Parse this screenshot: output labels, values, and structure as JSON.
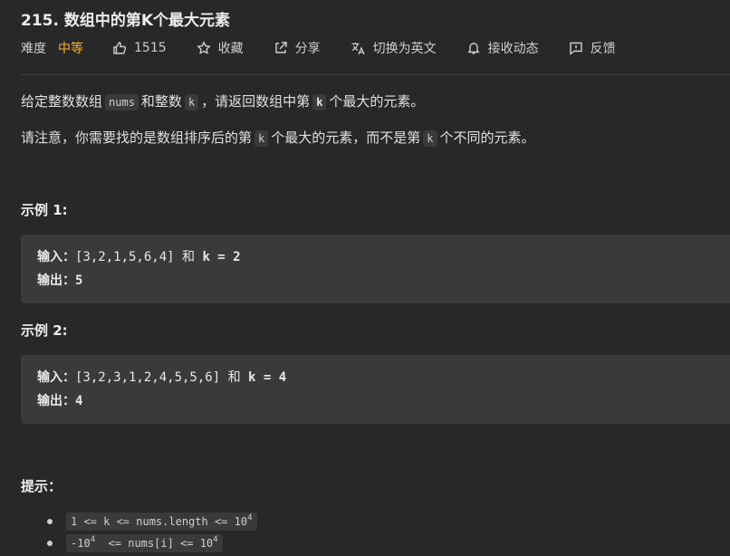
{
  "problem": {
    "title": "215. 数组中的第K个最大元素",
    "difficulty_label": "难度",
    "difficulty": "中等",
    "likes": "1515",
    "actions": {
      "favorite": "收藏",
      "share": "分享",
      "translate": "切换为英文",
      "subscribe": "接收动态",
      "feedback": "反馈"
    }
  },
  "description": {
    "p1": {
      "t1": "给定整数数组",
      "c1": "nums",
      "t2": "和整数",
      "c2": "k",
      "t3": "，请返回数组中第",
      "c3": "k",
      "t4": "个最大的元素。"
    },
    "p2": {
      "t1": "请注意，你需要找的是数组排序后的第",
      "c1": "k",
      "t2": "个最大的元素，而不是第",
      "c2": "k",
      "t3": "个不同的元素。"
    }
  },
  "examples": [
    {
      "title": "示例 1:",
      "input_label": "输入：",
      "input_value": "[3,2,1,5,6,4]",
      "and_word": "和",
      "k_expr": "k = 2",
      "output_label": "输出：",
      "output_value": "5"
    },
    {
      "title": "示例 2:",
      "input_label": "输入：",
      "input_value": "[3,2,3,1,2,4,5,5,6]",
      "and_word": "和",
      "k_expr": "k = 4",
      "output_label": "输出：",
      "output_value": "4"
    }
  ],
  "hints": {
    "title": "提示：",
    "items": [
      {
        "text": "1 <= k <= nums.length <= 10",
        "sup": "4"
      },
      {
        "pre": "-10",
        "pre_sup": "4",
        "text": "  <= nums[i] <= 10",
        "sup": "4"
      }
    ]
  },
  "colors": {
    "background": "#282828",
    "difficulty_medium": "#ffb02e",
    "code_background": "#3a3a3a"
  }
}
